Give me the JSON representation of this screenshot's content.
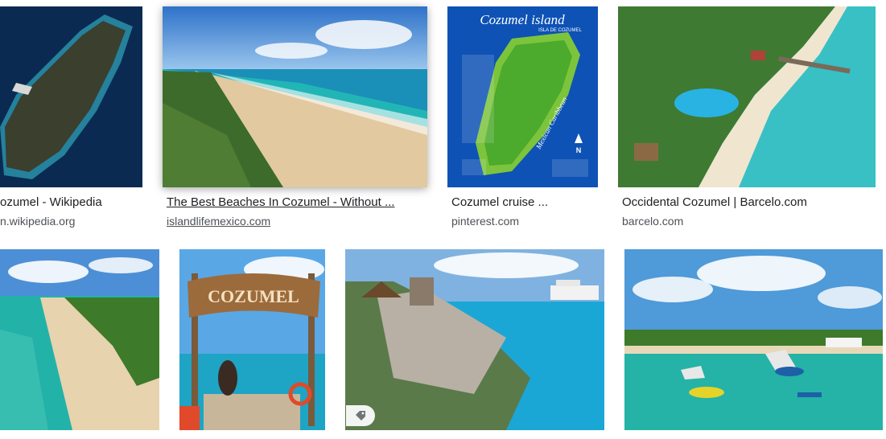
{
  "results": [
    {
      "title": "ozumel - Wikipedia",
      "source": "n.wikipedia.org"
    },
    {
      "title": "The Best Beaches In Cozumel - Without ...",
      "source": "islandlifemexico.com"
    },
    {
      "title": "Cozumel cruise ...",
      "source": "pinterest.com"
    },
    {
      "title": "Occidental Cozumel | Barcelo.com",
      "source": "barcelo.com"
    }
  ],
  "thumb_text": {
    "map_title": "Cozumel island",
    "map_subtitle": "ISLA DE COZUMEL",
    "map_sea_label": "Mexican Caribbean",
    "map_north": "N",
    "sign_text": "COZUMEL"
  },
  "badge_icon": "tag-icon"
}
